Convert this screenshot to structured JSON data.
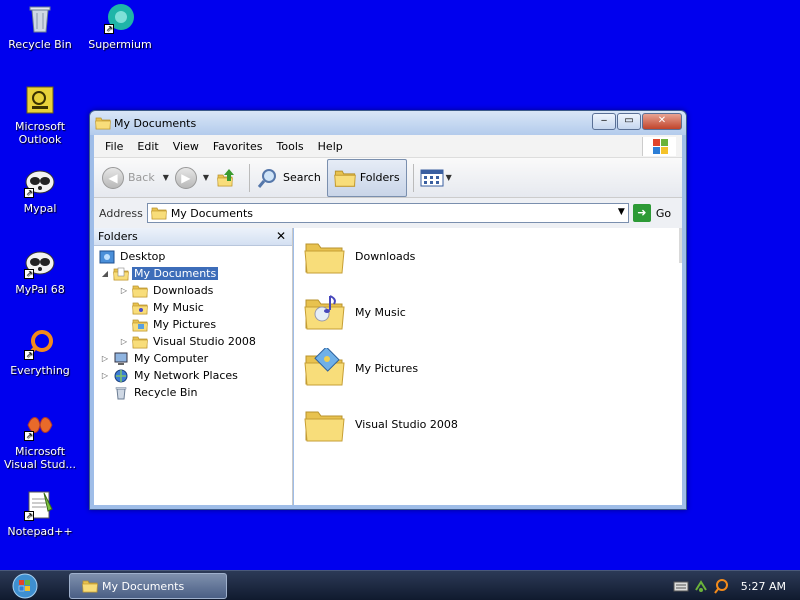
{
  "desktop": {
    "icons": [
      {
        "label": "Recycle Bin"
      },
      {
        "label": "Supermium"
      },
      {
        "label": "Microsoft Outlook"
      },
      {
        "label": "Mypal"
      },
      {
        "label": "MyPal 68"
      },
      {
        "label": "Everything"
      },
      {
        "label": "Microsoft Visual Stud..."
      },
      {
        "label": "Notepad++"
      }
    ]
  },
  "window": {
    "title": "My Documents",
    "menu": [
      "File",
      "Edit",
      "View",
      "Favorites",
      "Tools",
      "Help"
    ],
    "toolbar": {
      "back": "Back",
      "search": "Search",
      "folders": "Folders"
    },
    "address": {
      "label": "Address",
      "value": "My Documents",
      "go": "Go"
    },
    "folders_pane": {
      "title": "Folders",
      "tree": [
        {
          "label": "Desktop"
        },
        {
          "label": "My Documents"
        },
        {
          "label": "Downloads"
        },
        {
          "label": "My Music"
        },
        {
          "label": "My Pictures"
        },
        {
          "label": "Visual Studio 2008"
        },
        {
          "label": "My Computer"
        },
        {
          "label": "My Network Places"
        },
        {
          "label": "Recycle Bin"
        }
      ]
    },
    "items": [
      {
        "label": "Downloads"
      },
      {
        "label": "My Music"
      },
      {
        "label": "My Pictures"
      },
      {
        "label": "Visual Studio 2008"
      }
    ]
  },
  "taskbar": {
    "task": "My Documents",
    "clock": "5:27 AM"
  },
  "colors": {
    "desktop": "#0000ee",
    "selection": "#3d6db9",
    "folder": "#f4d56a"
  }
}
